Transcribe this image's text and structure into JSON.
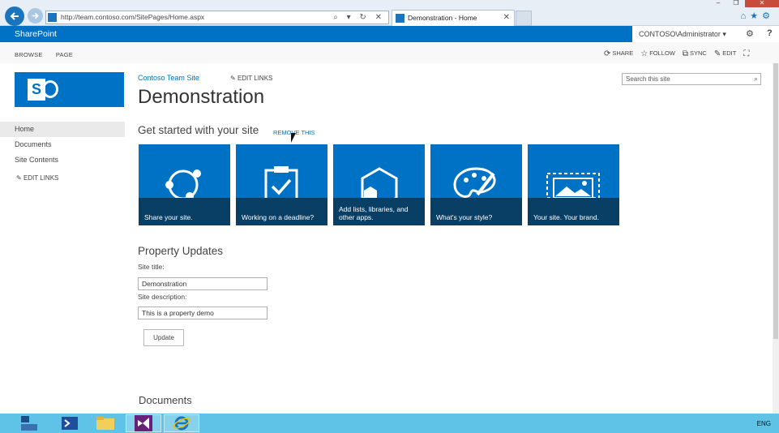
{
  "browser": {
    "url": "http://team.contoso.com/SitePages/Home.aspx",
    "tab_title": "Demonstration - Home",
    "tab_close": "✕",
    "url_controls": "⌕ ▾ ↻ ✕"
  },
  "suite_bar": {
    "brand": "SharePoint",
    "user": "CONTOSO\\Administrator ▾",
    "help": "?"
  },
  "ribbon": {
    "tabs": [
      "BROWSE",
      "PAGE"
    ],
    "actions": [
      "SHARE",
      "FOLLOW",
      "SYNC",
      "EDIT"
    ]
  },
  "site": {
    "name_link": "Contoso Team Site",
    "edit_links": "EDIT LINKS",
    "title": "Demonstration",
    "search_placeholder": "Search this site"
  },
  "left_nav": {
    "items": [
      "Home",
      "Documents",
      "Site Contents"
    ],
    "edit_links": "EDIT LINKS"
  },
  "get_started": {
    "title": "Get started with your site",
    "remove_link": "REMOVE THIS",
    "tiles": [
      {
        "label": "Share your site.",
        "icon": "share-icon"
      },
      {
        "label": "Working on a deadline?",
        "icon": "clipboard-check-icon"
      },
      {
        "label": "Add lists, libraries, and other apps.",
        "icon": "hexagon-apps-icon"
      },
      {
        "label": "What's your style?",
        "icon": "palette-icon"
      },
      {
        "label": "Your site. Your brand.",
        "icon": "image-brand-icon"
      }
    ]
  },
  "property_updates": {
    "title": "Property Updates",
    "site_title_label": "Site title:",
    "site_title_value": "Demonstration",
    "site_desc_label": "Site description:",
    "site_desc_value": "This is a property demo",
    "update_button": "Update"
  },
  "documents_heading": "Documents",
  "taskbar": {
    "language": "ENG"
  },
  "colors": {
    "brand_blue": "#0072c6",
    "tile_caption": "#0a3c60",
    "taskbar": "#5ec3e6"
  }
}
